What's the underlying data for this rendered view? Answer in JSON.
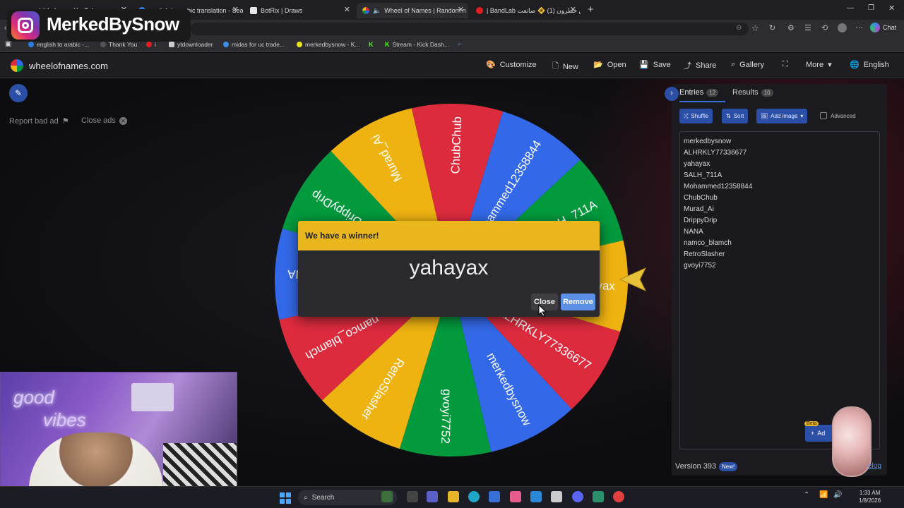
{
  "browser": {
    "tabs": [
      {
        "label": "a Little Love - YouTube",
        "color": "#ff0000"
      },
      {
        "label": "english to arabic translation - Search",
        "color": "#2f7de1"
      },
      {
        "label": "BotRix | Draws",
        "color": "#e6e6e6"
      },
      {
        "label": "Wheel of Names | Random n",
        "color": "#2f9e44"
      },
      {
        "label": "| BandLab نحن خطرون (1) 🚸 صانعت",
        "color": "#e02020"
      }
    ],
    "new_tab": "+",
    "chat_label": "Chat",
    "bookmarks": [
      "english to arabic -...",
      "Thank You",
      "i",
      "ytdownloader",
      "midas for uc trade...",
      "merkedbysnow - K...",
      "",
      "Stream - Kick Dash..."
    ]
  },
  "overlay": {
    "instagram_handle": "MerkedBySnow",
    "neon_text_1": "good",
    "neon_text_2": "vibes"
  },
  "site": {
    "logo": "wheelofnames.com",
    "nav": [
      "Customize",
      "New",
      "Open",
      "Save",
      "Share",
      "Gallery",
      "More",
      "English"
    ],
    "report_bad_ad": "Report bad ad",
    "close_ads": "Close ads"
  },
  "wheel": {
    "segments": [
      {
        "name": "ChubChub",
        "color": "#dd2b3e"
      },
      {
        "name": "Mohammed12358844",
        "color": "#3369e8"
      },
      {
        "name": "SALH_711A",
        "color": "#039a3e"
      },
      {
        "name": "yahayax",
        "color": "#eeb211"
      },
      {
        "name": "ALHRKLY77336677",
        "color": "#dd2b3e"
      },
      {
        "name": "merkedbysnow",
        "color": "#3369e8"
      },
      {
        "name": "gvoyi7752",
        "color": "#039a3e"
      },
      {
        "name": "RetroSlasher",
        "color": "#eeb211"
      },
      {
        "name": "namco_blamch",
        "color": "#dd2b3e"
      },
      {
        "name": "NANA",
        "color": "#3369e8"
      },
      {
        "name": "DrippyDrip",
        "color": "#039a3e"
      },
      {
        "name": "Murad_Ai",
        "color": "#eeb211"
      }
    ]
  },
  "dialog": {
    "title": "We have a winner!",
    "winner": "yahayax",
    "close_label": "Close",
    "remove_label": "Remove"
  },
  "panel": {
    "entries_tab": "Entries",
    "entries_count": "12",
    "results_tab": "Results",
    "results_count": "10",
    "shuffle": "Shuffle",
    "sort": "Sort",
    "add_image": "Add image",
    "advanced": "Advanced",
    "entries": [
      "merkedbysnow",
      "ALHRKLY77336677",
      "yahayax",
      "SALH_711A",
      "Mohammed12358844",
      "ChubChub",
      "Murad_Ai",
      "DrippyDrip",
      "NANA",
      "namco_blamch",
      "RetroSlasher",
      "gvoyi7752"
    ],
    "version": "Version 393",
    "new_badge": "New!",
    "beta_badge": "Beta",
    "add_label": "Ad",
    "changelog": "elog"
  },
  "taskbar": {
    "search": "Search",
    "time": "1:33 AM",
    "date": "1/8/2026"
  },
  "colors": {
    "accent": "#2b4fa7",
    "dialog_header": "#e9b71d",
    "remove_button": "#5c8fe6"
  }
}
